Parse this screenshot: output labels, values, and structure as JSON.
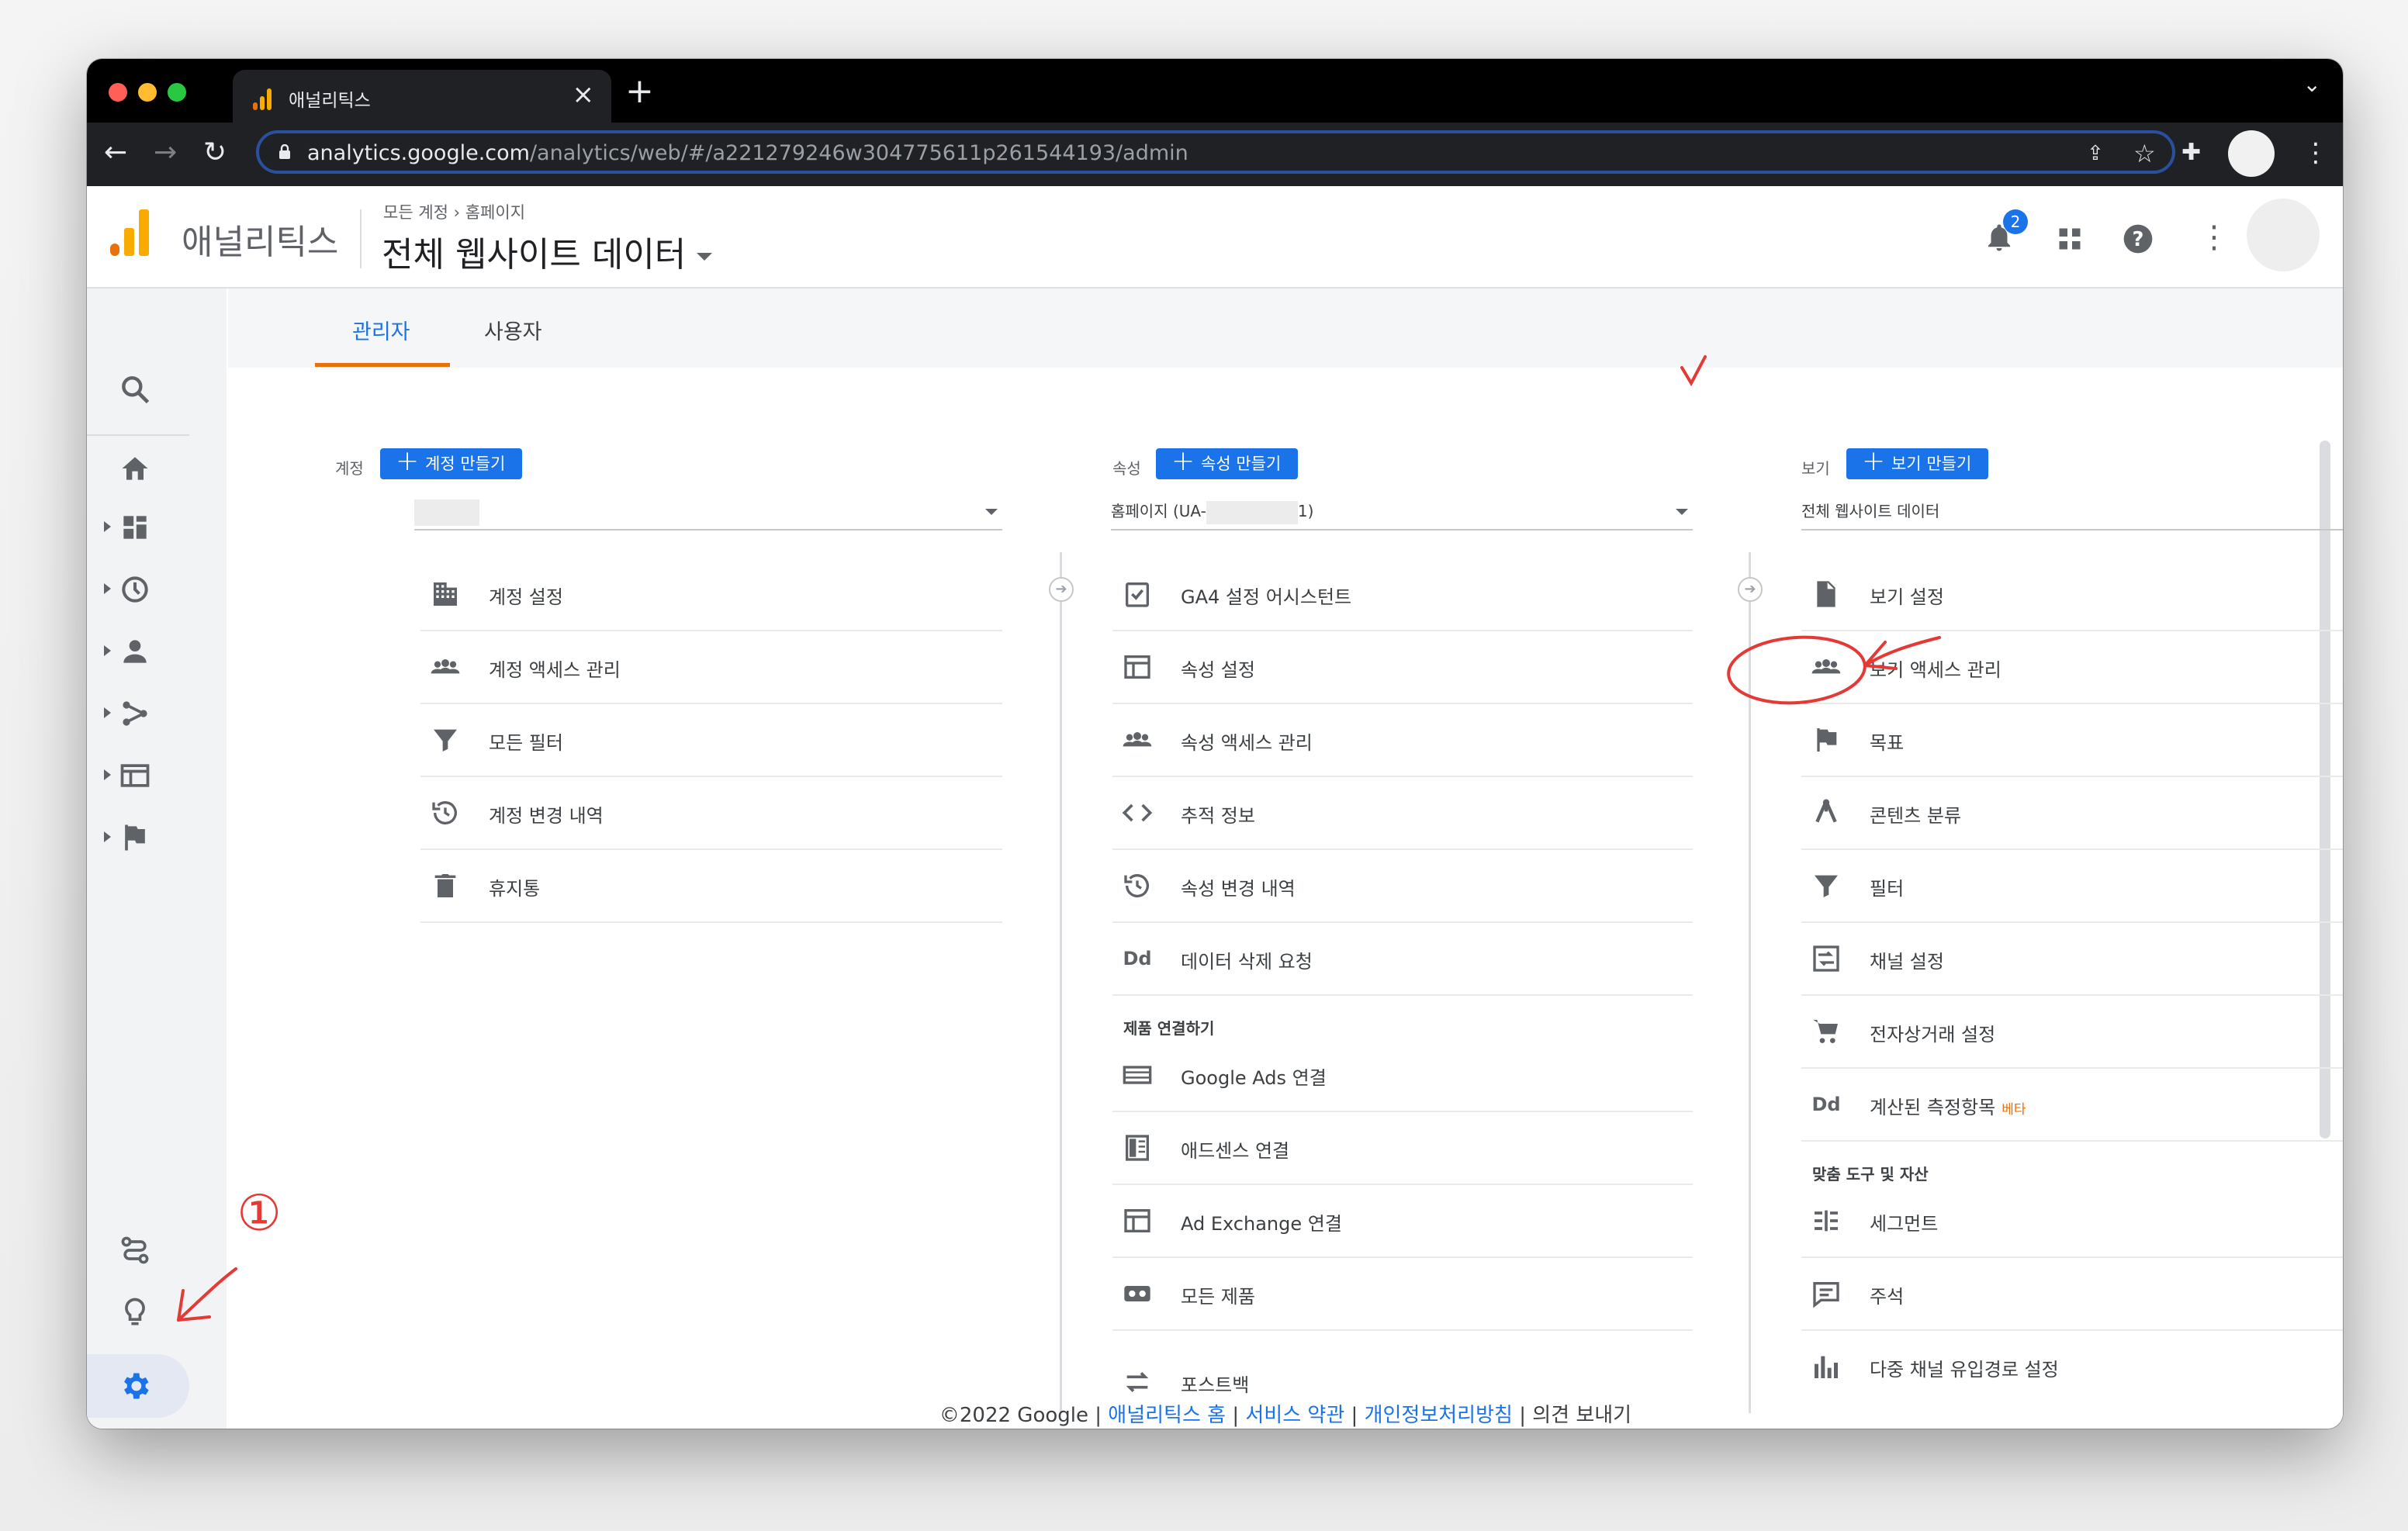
{
  "browser": {
    "tab_title": "애널리틱스",
    "url_host": "analytics.google.com",
    "url_path": "/analytics/web/#/a221279246w304775611p261544193/admin"
  },
  "header": {
    "brand": "애널리틱스",
    "breadcrumb_account": "모든 계정",
    "breadcrumb_property": "홈페이지",
    "view_title": "전체 웹사이트 데이터",
    "notification_count": "2"
  },
  "subtabs": {
    "admin": "관리자",
    "user": "사용자"
  },
  "account_column": {
    "label": "계정",
    "create_label": "계정 만들기",
    "selected": "",
    "items": [
      {
        "label": "계정 설정",
        "icon": "building-icon"
      },
      {
        "label": "계정 액세스 관리",
        "icon": "people-icon"
      },
      {
        "label": "모든 필터",
        "icon": "filter-icon"
      },
      {
        "label": "계정 변경 내역",
        "icon": "history-icon"
      },
      {
        "label": "휴지통",
        "icon": "trash-icon"
      }
    ]
  },
  "property_column": {
    "label": "속성",
    "create_label": "속성 만들기",
    "selected_prefix": "홈페이지 (UA-",
    "selected_suffix": "1)",
    "items": [
      {
        "label": "GA4 설정 어시스턴트",
        "icon": "checkbox-icon"
      },
      {
        "label": "속성 설정",
        "icon": "window-icon"
      },
      {
        "label": "속성 액세스 관리",
        "icon": "people-icon"
      },
      {
        "label": "추적 정보",
        "icon": "code-icon"
      },
      {
        "label": "속성 변경 내역",
        "icon": "history-icon"
      },
      {
        "label": "데이터 삭제 요청",
        "icon": "dd-icon",
        "icon_text": "Dd"
      }
    ],
    "section_products": "제품 연결하기",
    "product_items": [
      {
        "label": "Google Ads 연결",
        "icon": "ads-icon"
      },
      {
        "label": "애드센스 연결",
        "icon": "adsense-icon"
      },
      {
        "label": "Ad Exchange 연결",
        "icon": "window-icon"
      },
      {
        "label": "모든 제품",
        "icon": "products-icon"
      },
      {
        "label": "포스트백",
        "icon": "postback-icon"
      }
    ]
  },
  "view_column": {
    "label": "보기",
    "create_label": "보기 만들기",
    "selected": "전체 웹사이트 데이터",
    "items": [
      {
        "label": "보기 설정",
        "icon": "document-icon"
      },
      {
        "label": "보기 액세스 관리",
        "icon": "people-icon"
      },
      {
        "label": "목표",
        "icon": "flag-icon"
      },
      {
        "label": "콘텐츠 분류",
        "icon": "content-grouping-icon"
      },
      {
        "label": "필터",
        "icon": "filter-icon"
      },
      {
        "label": "채널 설정",
        "icon": "channel-icon"
      },
      {
        "label": "전자상거래 설정",
        "icon": "cart-icon"
      },
      {
        "label": "계산된 측정항목",
        "icon": "dd-icon",
        "icon_text": "Dd",
        "badge": "베타"
      }
    ],
    "section_tools": "맞춤 도구 및 자산",
    "tool_items": [
      {
        "label": "세그먼트",
        "icon": "segment-icon"
      },
      {
        "label": "주석",
        "icon": "comment-icon"
      },
      {
        "label": "다중 채널 유입경로 설정",
        "icon": "bar-chart-icon"
      }
    ]
  },
  "footer": {
    "copyright": "©2022 Google |",
    "link_home": "애널리틱스 홈",
    "sep1": "|",
    "link_terms": "서비스 약관",
    "sep2": "|",
    "link_privacy": "개인정보처리방침",
    "sep3": "|",
    "feedback": "의견 보내기"
  },
  "annotations": {
    "circled_number": "①"
  },
  "colors": {
    "accent_blue": "#1a73e8",
    "tab_underline": "#e8710a",
    "annotation_red": "#e53935"
  }
}
